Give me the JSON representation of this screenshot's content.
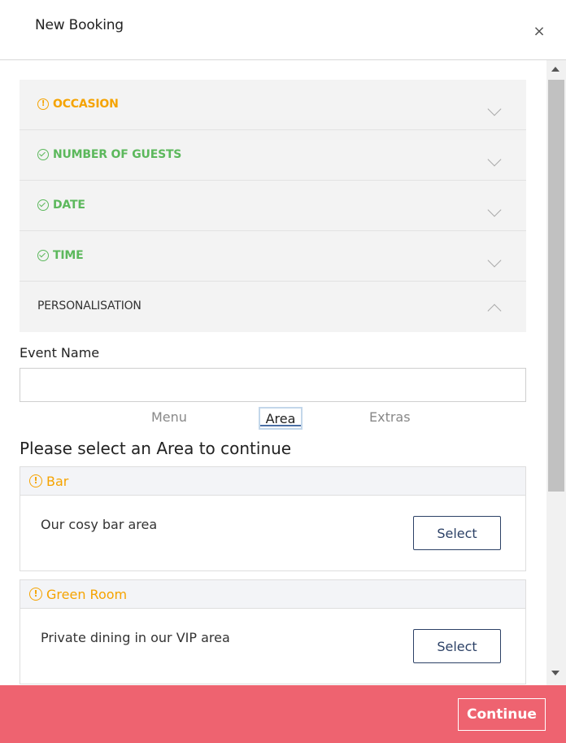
{
  "header": {
    "title": "New Booking",
    "close_symbol": "×"
  },
  "accordion": {
    "items": [
      {
        "label": "OCCASION",
        "status": "warning",
        "icon": "warning-circle-icon",
        "expanded": false
      },
      {
        "label": "NUMBER OF GUESTS",
        "status": "complete",
        "icon": "check-circle-icon",
        "expanded": false
      },
      {
        "label": "DATE",
        "status": "complete",
        "icon": "check-circle-icon",
        "expanded": false
      },
      {
        "label": "TIME",
        "status": "complete",
        "icon": "check-circle-icon",
        "expanded": false
      },
      {
        "label": "PERSONALISATION",
        "status": "none",
        "icon": "",
        "expanded": true
      }
    ]
  },
  "form": {
    "event_name_label": "Event Name",
    "event_name_value": "",
    "event_name_placeholder": ""
  },
  "tabs": [
    {
      "label": "Menu",
      "active": false
    },
    {
      "label": "Area",
      "active": true
    },
    {
      "label": "Extras",
      "active": false
    }
  ],
  "instruction": "Please select an Area to continue",
  "areas": [
    {
      "name": "Bar",
      "description": "Our cosy bar area",
      "button": "Select"
    },
    {
      "name": "Green Room",
      "description": "Private dining in our VIP area",
      "button": "Select"
    }
  ],
  "footer": {
    "continue_label": "Continue"
  },
  "colors": {
    "warning": "#f5a300",
    "success": "#5cb85c",
    "footer_bg": "#ee6370",
    "button_text": "#2c4166"
  }
}
